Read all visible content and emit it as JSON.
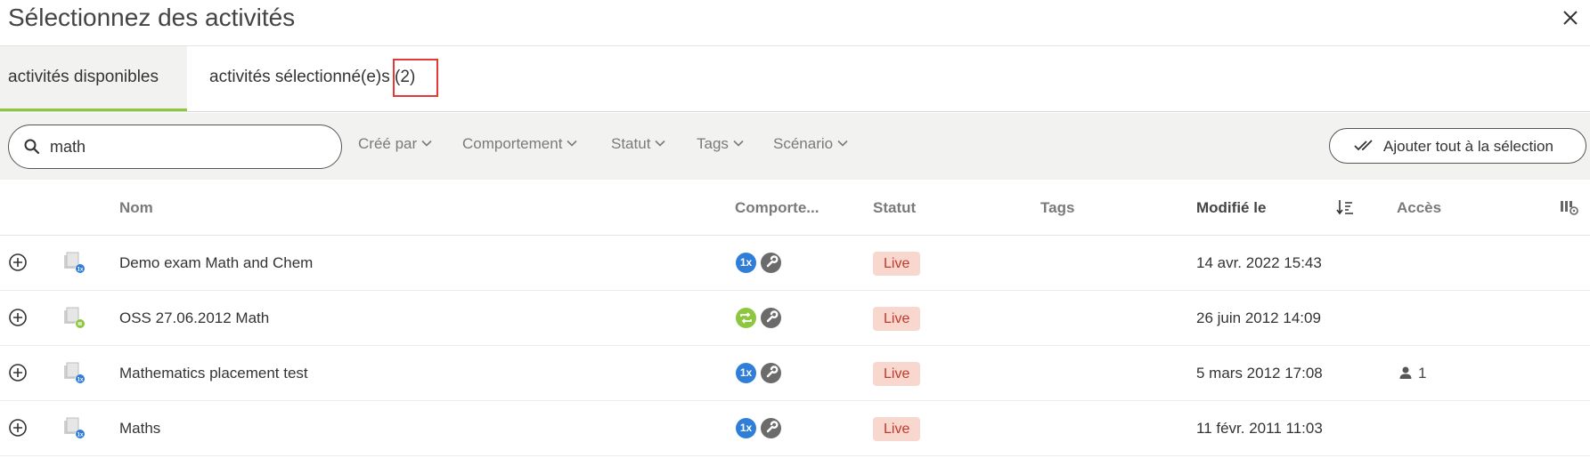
{
  "dialog": {
    "title": "Sélectionnez des activités"
  },
  "tabs": [
    {
      "label": "activités disponibles"
    },
    {
      "label": "activités sélectionné(e)s",
      "count": "(2)"
    }
  ],
  "search": {
    "value": "math",
    "icon": "search-icon"
  },
  "filters": [
    "Créé par",
    "Comportement",
    "Statut",
    "Tags",
    "Scénario"
  ],
  "actions": {
    "add_all_label": "Ajouter tout à la sélection"
  },
  "table": {
    "columns": {
      "name": "Nom",
      "behavior": "Comporte...",
      "status": "Statut",
      "tags": "Tags",
      "modified": "Modifié le",
      "access": "Accès"
    },
    "rows": [
      {
        "name": "Demo exam Math and Chem",
        "behavior": "1x",
        "status": "Live",
        "modified": "14 avr. 2022 15:43",
        "access": ""
      },
      {
        "name": "OSS 27.06.2012 Math",
        "behavior": "loop",
        "status": "Live",
        "modified": "26 juin 2012 14:09",
        "access": ""
      },
      {
        "name": "Mathematics placement test",
        "behavior": "1x",
        "status": "Live",
        "modified": "5 mars 2012 17:08",
        "access": "1"
      },
      {
        "name": "Maths",
        "behavior": "1x",
        "status": "Live",
        "modified": "11 févr. 2011 11:03",
        "access": ""
      }
    ]
  },
  "colors": {
    "accent": "#8dc63f",
    "badge_blue": "#2f7ed8",
    "status_bg": "#f8d7cf",
    "status_text": "#c0392b",
    "highlight": "#e53935"
  }
}
